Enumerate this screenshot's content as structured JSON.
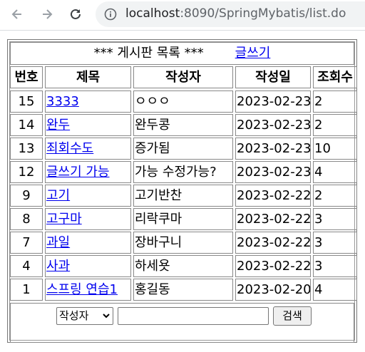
{
  "browser": {
    "url_host": "localhost",
    "url_rest": ":8090/SpringMybatis/list.do"
  },
  "board": {
    "heading": "*** 게시판 목록 ***",
    "write_link": "글쓰기",
    "columns": [
      "번호",
      "제목",
      "작성자",
      "작성일",
      "조회수"
    ],
    "rows": [
      {
        "num": "15",
        "title": "3333",
        "author": "ㅇㅇㅇ",
        "date": "2023-02-23",
        "views": "2"
      },
      {
        "num": "14",
        "title": "완두",
        "author": "완두콩",
        "date": "2023-02-23",
        "views": "2"
      },
      {
        "num": "13",
        "title": "죄회수도",
        "author": "증가됨",
        "date": "2023-02-23",
        "views": "10"
      },
      {
        "num": "12",
        "title": "글쓰기 가능",
        "author": "가능 수정가능?",
        "date": "2023-02-23",
        "views": "4"
      },
      {
        "num": "9",
        "title": "고기",
        "author": "고기반찬",
        "date": "2023-02-22",
        "views": "2"
      },
      {
        "num": "8",
        "title": "고구마",
        "author": "리락쿠마",
        "date": "2023-02-22",
        "views": "3"
      },
      {
        "num": "7",
        "title": "과일",
        "author": "장바구니",
        "date": "2023-02-22",
        "views": "3"
      },
      {
        "num": "4",
        "title": "사과",
        "author": "하세욧",
        "date": "2023-02-22",
        "views": "3"
      },
      {
        "num": "1",
        "title": "스프링 연습1",
        "author": "홍길동",
        "date": "2023-02-20",
        "views": "4"
      }
    ]
  },
  "search": {
    "field_selected": "작성자",
    "query": "",
    "button_label": "검색"
  }
}
